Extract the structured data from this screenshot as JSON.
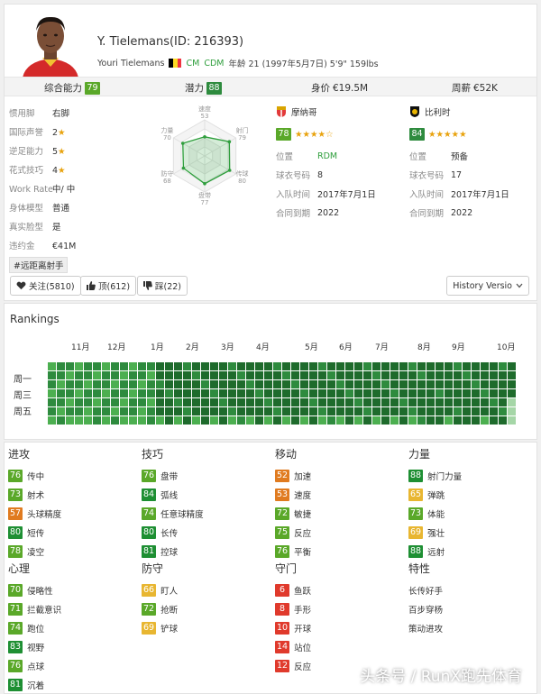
{
  "player": {
    "name": "Y. Tielemans(ID: 216393)",
    "fullname": "Youri Tielemans",
    "pos1": "CM",
    "pos2": "CDM",
    "bio": "年龄 21 (1997年5月7日) 5'9\" 159lbs",
    "flag_colors": [
      "#000000",
      "#FDDA24",
      "#EF3340"
    ]
  },
  "stats_bar": {
    "overall_label": "综合能力",
    "overall": "79",
    "potential_label": "潜力",
    "potential": "88",
    "value_label": "身价",
    "value": "€19.5M",
    "wage_label": "周薪",
    "wage": "€52K"
  },
  "attributes": [
    {
      "k": "惯用脚",
      "v": "右脚"
    },
    {
      "k": "国际声誉",
      "v": "2"
    },
    {
      "k": "逆足能力",
      "v": "5"
    },
    {
      "k": "花式技巧",
      "v": "4"
    },
    {
      "k": "Work Rate",
      "v": "中/ 中"
    },
    {
      "k": "身体模型",
      "v": "普通"
    },
    {
      "k": "真实脸型",
      "v": "是"
    },
    {
      "k": "违约金",
      "v": "€41M"
    }
  ],
  "trait_tag": "#远距离射手",
  "radar": {
    "labels": [
      "速度",
      "射门",
      "传球",
      "盘带",
      "防守",
      "力量"
    ],
    "values": [
      53,
      79,
      80,
      77,
      68,
      70
    ]
  },
  "clubs": [
    {
      "name": "摩纳哥",
      "rating": "78",
      "stars": "★★★★☆",
      "lines": [
        {
          "k": "位置",
          "v": "RDM"
        },
        {
          "k": "球衣号码",
          "v": "8"
        },
        {
          "k": "入队时间",
          "v": "2017年7月1日"
        },
        {
          "k": "合同到期",
          "v": "2022"
        }
      ]
    },
    {
      "name": "比利时",
      "rating": "84",
      "stars": "★★★★★",
      "lines": [
        {
          "k": "位置",
          "v": "预备"
        },
        {
          "k": "球衣号码",
          "v": "17"
        },
        {
          "k": "入队时间",
          "v": "2017年7月1日"
        },
        {
          "k": "合同到期",
          "v": "2022"
        }
      ]
    }
  ],
  "buttons": {
    "follow": "关注(5810)",
    "up": "顶(612)",
    "down": "踩(22)",
    "history": "History Versio"
  },
  "icons": {
    "heart": "heart-icon",
    "thumbs_up": "thumbs-up-icon",
    "thumbs_down": "thumbs-down-icon",
    "chevron": "chevron-down-icon",
    "monaco": "monaco-crest-icon",
    "belgium": "belgium-crest-icon"
  },
  "rankings": {
    "title": "Rankings",
    "months": [
      "11月",
      "12月",
      "1月",
      "2月",
      "3月",
      "4月",
      "5月",
      "6月",
      "7月",
      "8月",
      "9月",
      "10月"
    ],
    "days": [
      "周一",
      "周三",
      "周五"
    ],
    "weeks": 52,
    "colors": [
      "#1e6b2c",
      "#2e8b3e",
      "#4caf50",
      "#a5d6a7"
    ]
  },
  "groups": [
    {
      "title": "进攻",
      "items": [
        {
          "v": "76",
          "n": "传中"
        },
        {
          "v": "73",
          "n": "射术"
        },
        {
          "v": "57",
          "n": "头球精度"
        },
        {
          "v": "80",
          "n": "短传"
        },
        {
          "v": "78",
          "n": "凌空"
        }
      ]
    },
    {
      "title": "技巧",
      "items": [
        {
          "v": "76",
          "n": "盘带"
        },
        {
          "v": "84",
          "n": "弧线"
        },
        {
          "v": "74",
          "n": "任意球精度"
        },
        {
          "v": "80",
          "n": "长传"
        },
        {
          "v": "81",
          "n": "控球"
        }
      ]
    },
    {
      "title": "移动",
      "items": [
        {
          "v": "52",
          "n": "加速"
        },
        {
          "v": "53",
          "n": "速度"
        },
        {
          "v": "72",
          "n": "敏捷"
        },
        {
          "v": "75",
          "n": "反应"
        },
        {
          "v": "76",
          "n": "平衡"
        }
      ]
    },
    {
      "title": "力量",
      "items": [
        {
          "v": "88",
          "n": "射门力量"
        },
        {
          "v": "65",
          "n": "弹跳"
        },
        {
          "v": "73",
          "n": "体能"
        },
        {
          "v": "69",
          "n": "强壮"
        },
        {
          "v": "88",
          "n": "远射"
        }
      ]
    },
    {
      "title": "心理",
      "items": [
        {
          "v": "70",
          "n": "侵略性"
        },
        {
          "v": "71",
          "n": "拦截意识"
        },
        {
          "v": "74",
          "n": "跑位"
        },
        {
          "v": "83",
          "n": "视野"
        },
        {
          "v": "76",
          "n": "点球"
        },
        {
          "v": "81",
          "n": "沉着"
        }
      ]
    },
    {
      "title": "防守",
      "items": [
        {
          "v": "66",
          "n": "盯人"
        },
        {
          "v": "72",
          "n": "抢断"
        },
        {
          "v": "69",
          "n": "铲球"
        }
      ]
    },
    {
      "title": "守门",
      "items": [
        {
          "v": "6",
          "n": "鱼跃"
        },
        {
          "v": "8",
          "n": "手形"
        },
        {
          "v": "10",
          "n": "开球"
        },
        {
          "v": "14",
          "n": "站位"
        },
        {
          "v": "12",
          "n": "反应"
        }
      ]
    },
    {
      "title": "特性",
      "items": [
        {
          "v": "",
          "n": "长传好手"
        },
        {
          "v": "",
          "n": "百步穿杨"
        },
        {
          "v": "",
          "n": "策动进攻"
        }
      ]
    }
  ],
  "watermark": "头条号 / RunX跑先体育"
}
